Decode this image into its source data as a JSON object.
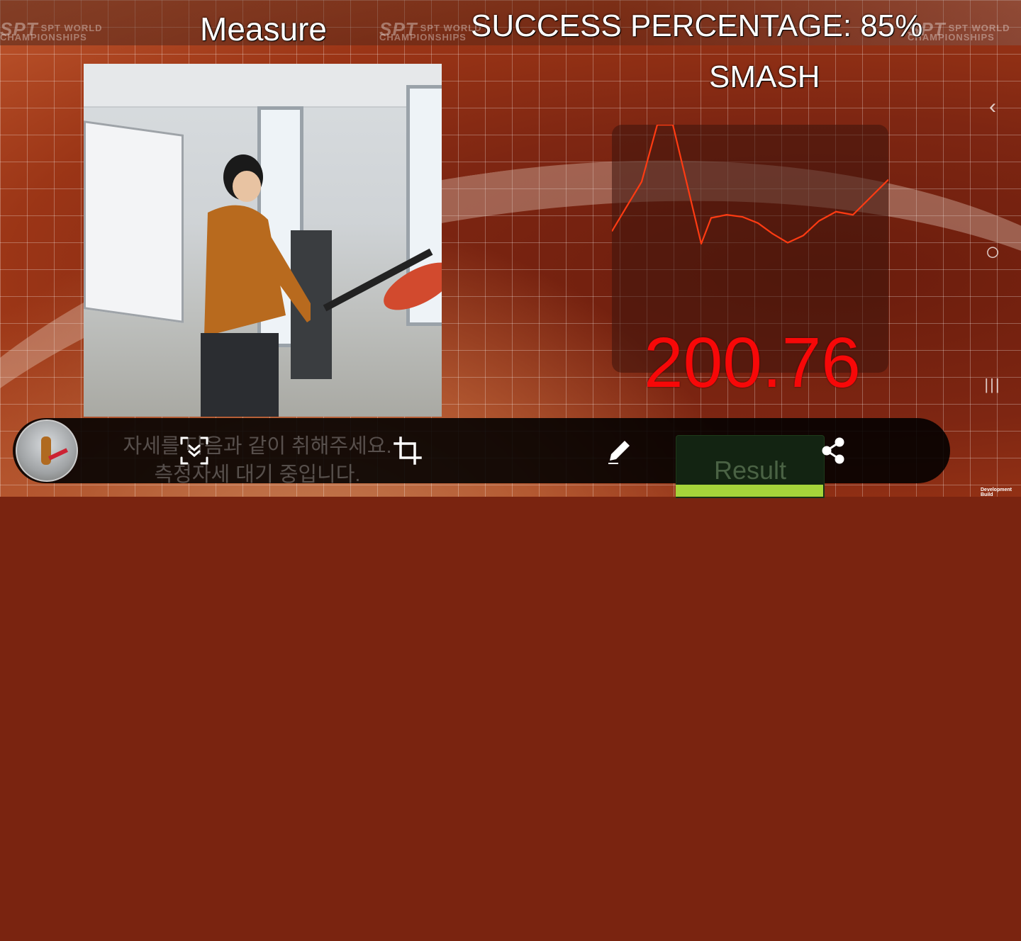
{
  "header": {
    "title": "Measure",
    "success": "SUCCESS PERCENTAGE: 85%",
    "shot_type": "SMASH"
  },
  "sponsor": {
    "logo": "SPT",
    "line1": "SPT WORLD",
    "line2": "CHAMPIONSHIPS"
  },
  "measurement": {
    "value": "200.76"
  },
  "chart_data": {
    "type": "line",
    "title": "",
    "xlabel": "",
    "ylabel": "",
    "x": [
      0,
      1,
      2,
      3,
      4,
      5,
      6,
      7,
      8,
      9,
      10,
      11,
      12,
      13,
      14,
      15,
      16
    ],
    "values": [
      0.12,
      0.35,
      0.6,
      1.15,
      1.15,
      0.0,
      0.25,
      0.28,
      0.26,
      0.2,
      0.1,
      0.01,
      0.08,
      0.22,
      0.31,
      0.28,
      0.62
    ],
    "ylim": [
      0,
      1
    ],
    "color": "#ff3b12",
    "grid": false
  },
  "guide": {
    "line1": "자세를 다음과 같이 취해주세요.",
    "line2": "측정자세 대기 중입니다."
  },
  "toolbar": {
    "result_label": "Result",
    "icons": [
      "capture-icon",
      "crop-icon",
      "pencil-icon",
      "share-icon"
    ]
  },
  "nav": {
    "back": "‹",
    "home": "○",
    "recents": "|||"
  },
  "footer": {
    "dev_build": "Development Build"
  },
  "colors": {
    "score": "#f70808",
    "result_bar": "#a6d43a",
    "line": "#ff3b12"
  }
}
